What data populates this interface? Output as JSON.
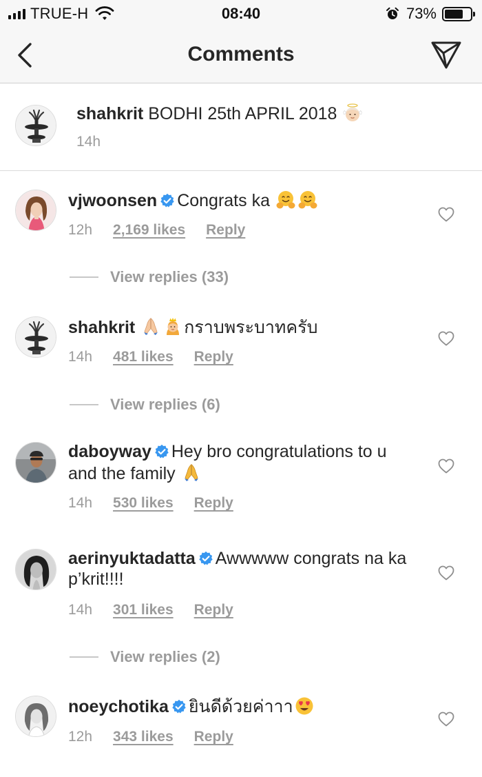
{
  "status_bar": {
    "carrier": "TRUE-H",
    "time": "08:40",
    "battery_percent": "73%",
    "battery_level": 0.73
  },
  "nav": {
    "title": "Comments",
    "back_icon": "chevron-left-icon",
    "send_icon": "paper-plane-icon"
  },
  "caption": {
    "username": "shahkrit",
    "text": "BODHI 25th APRIL 2018",
    "emoji": "baby-angel-emoji",
    "time": "14h"
  },
  "comments": [
    {
      "username": "vjwoonsen",
      "verified": true,
      "text": "Congrats ka",
      "emoji": "hugging-face-emoji x2",
      "time": "12h",
      "likes": "2,169 likes",
      "reply": "Reply",
      "view_replies": "View replies (33)"
    },
    {
      "username": "shahkrit",
      "verified": false,
      "text": "กราบพระบาทครับ",
      "emoji": "folded-hands-emoji, princess-emoji",
      "time": "14h",
      "likes": "481 likes",
      "reply": "Reply",
      "view_replies": "View replies (6)"
    },
    {
      "username": "daboyway",
      "verified": true,
      "text": "Hey bro congratulations to u and the family",
      "emoji": "folded-hands-emoji",
      "time": "14h",
      "likes": "530 likes",
      "reply": "Reply"
    },
    {
      "username": "aerinyuktadatta",
      "verified": true,
      "text": "Awwwww congrats na ka p’krit!!!!",
      "time": "14h",
      "likes": "301 likes",
      "reply": "Reply",
      "view_replies": "View replies (2)"
    },
    {
      "username": "noeychotika",
      "verified": true,
      "text": "ยินดีด้วยค่าาา",
      "emoji": "heart-eyes-emoji",
      "time": "12h",
      "likes": "343 likes",
      "reply": "Reply"
    }
  ],
  "colors": {
    "text": "#262626",
    "muted": "#9b9b9b",
    "verified_blue": "#3897f0",
    "bar_background": "#f7f7f7"
  }
}
